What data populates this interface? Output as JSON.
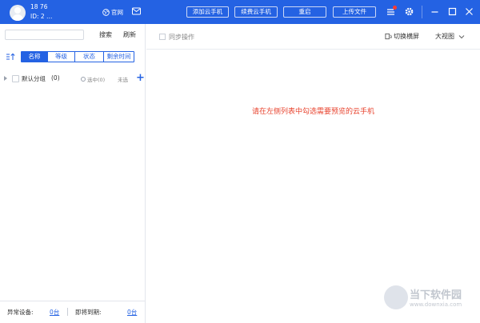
{
  "header": {
    "user_line1": "18        76",
    "user_line2": "ID: 2     …",
    "official_label": "官网",
    "buttons": {
      "add_phone": "添加云手机",
      "renew_phone": "续费云手机",
      "restart": "重启",
      "upload": "上传文件"
    },
    "icons": [
      "user-avatar",
      "globe-icon",
      "mail-icon",
      "menu-icon",
      "gear-icon",
      "minimize-icon",
      "maximize-icon",
      "close-icon"
    ],
    "brand_color": "#2462e3"
  },
  "sidebar": {
    "search_placeholder": "",
    "search_label": "搜索",
    "refresh_label": "刷新",
    "sort_tabs": [
      {
        "label": "名称",
        "active": true
      },
      {
        "label": "等级",
        "active": false
      },
      {
        "label": "状态",
        "active": false
      },
      {
        "label": "剩余时间",
        "active": false
      }
    ],
    "group": {
      "name": "默认分组",
      "count": "(0)",
      "selected": "选中(0)",
      "unselect": "未选",
      "add": "+"
    },
    "footer": {
      "abnormal_label": "异常设备:",
      "abnormal_value": "0台",
      "expiring_label": "即将到期:",
      "expiring_value": "0台"
    }
  },
  "main": {
    "sync_label": "同步操作",
    "rotate_label": "切换横屏",
    "view_label": "大视图",
    "placeholder": "请在左侧列表中勾选需要预览的云手机",
    "placeholder_color": "#e8432e"
  },
  "watermark": {
    "line1": "当下软件园",
    "line2": "www.downxia.com"
  }
}
